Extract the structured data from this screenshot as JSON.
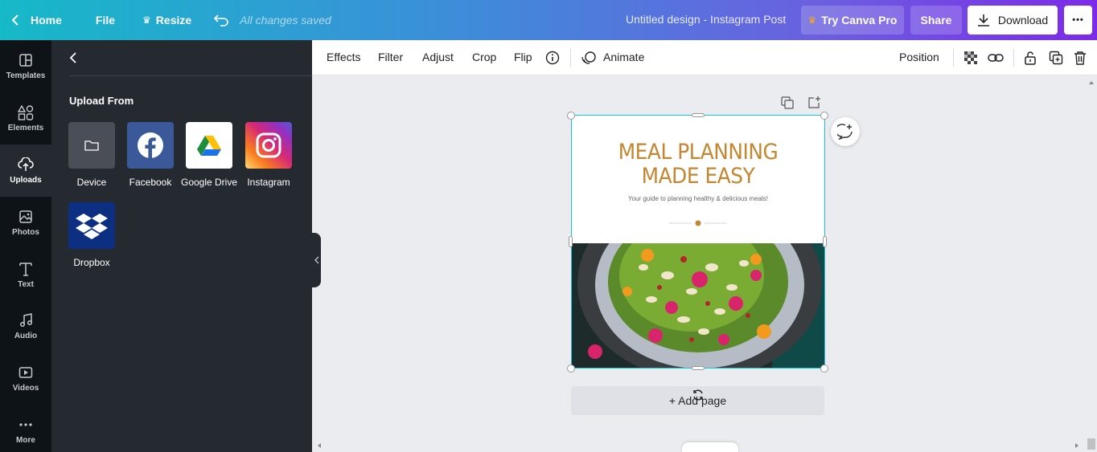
{
  "topbar": {
    "home_label": "Home",
    "file_label": "File",
    "resize_label": "Resize",
    "saved_status": "All changes saved",
    "design_title": "Untitled design - Instagram Post",
    "pro_label": "Try Canva Pro",
    "share_label": "Share",
    "download_label": "Download",
    "more_label": "•••"
  },
  "rail": {
    "items": [
      {
        "label": "Templates",
        "icon": "templates-icon"
      },
      {
        "label": "Elements",
        "icon": "elements-icon"
      },
      {
        "label": "Uploads",
        "icon": "uploads-icon",
        "active": true
      },
      {
        "label": "Photos",
        "icon": "photos-icon"
      },
      {
        "label": "Text",
        "icon": "text-icon"
      },
      {
        "label": "Audio",
        "icon": "audio-icon"
      },
      {
        "label": "Videos",
        "icon": "videos-icon"
      },
      {
        "label": "More",
        "icon": "more-icon"
      }
    ]
  },
  "panel": {
    "heading": "Upload From",
    "sources": [
      {
        "label": "Device",
        "icon": "folder-icon"
      },
      {
        "label": "Facebook",
        "icon": "facebook-icon"
      },
      {
        "label": "Google Drive",
        "icon": "google-drive-icon"
      },
      {
        "label": "Instagram",
        "icon": "instagram-icon"
      },
      {
        "label": "Dropbox",
        "icon": "dropbox-icon"
      }
    ]
  },
  "context_toolbar": {
    "effects": "Effects",
    "filter": "Filter",
    "adjust": "Adjust",
    "crop": "Crop",
    "flip": "Flip",
    "animate": "Animate",
    "position": "Position"
  },
  "design": {
    "title_line1": "MEAL PLANNING",
    "title_line2": "MADE EASY",
    "subtitle": "Your guide to planning healthy & delicious meals!",
    "title_color": "#c6862f"
  },
  "canvas": {
    "add_page_label": "+ Add page"
  },
  "colors": {
    "accent": "#7d2ae8",
    "selection": "#13c2d6"
  }
}
